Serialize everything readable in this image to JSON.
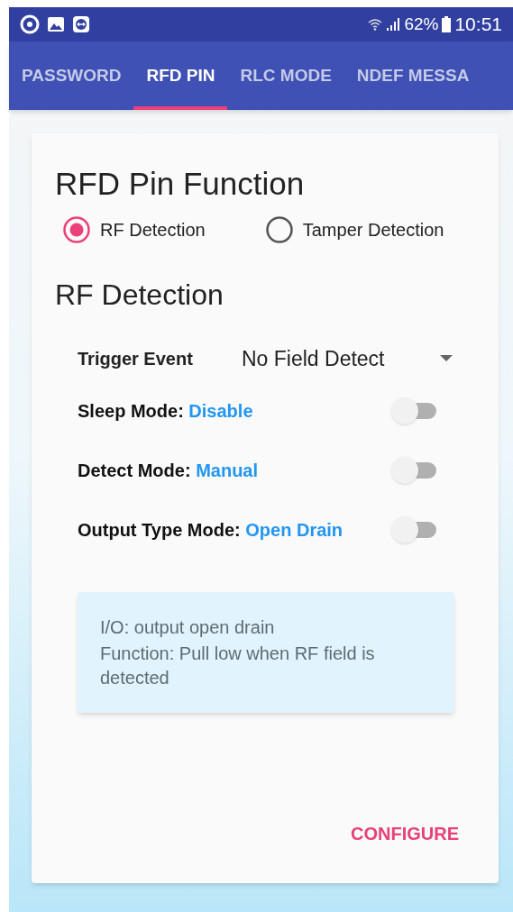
{
  "status_bar": {
    "battery": "62%",
    "time": "10:51"
  },
  "tabs": [
    {
      "label": "PASSWORD",
      "selected": false
    },
    {
      "label": "RFD PIN",
      "selected": true
    },
    {
      "label": "RLC MODE",
      "selected": false
    },
    {
      "label": "NDEF MESSA",
      "selected": false
    }
  ],
  "card": {
    "title": "RFD Pin Function",
    "radios": [
      {
        "label": "RF Detection",
        "selected": true
      },
      {
        "label": "Tamper Detection",
        "selected": false
      }
    ],
    "section_title": "RF Detection",
    "trigger": {
      "label": "Trigger Event",
      "value": "No Field Detect"
    },
    "switches": [
      {
        "label": "Sleep Mode:",
        "value": "Disable",
        "on": false
      },
      {
        "label": "Detect Mode:",
        "value": "Manual",
        "on": false
      },
      {
        "label": "Output Type Mode:",
        "value": "Open Drain",
        "on": false
      }
    ],
    "info_lines": [
      "I/O: output open drain",
      "Function: Pull low when RF field is detected"
    ],
    "button": "CONFIGURE"
  }
}
